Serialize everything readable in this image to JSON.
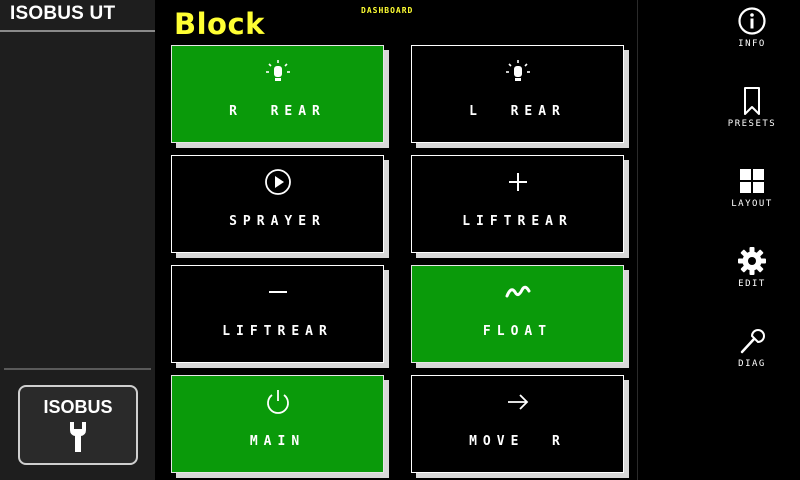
{
  "app": {
    "title": "ISOBUS UT"
  },
  "left_panel": {
    "isobus_button_label": "ISOBUS"
  },
  "header": {
    "title": "Block",
    "subtitle": "DASHBOARD"
  },
  "tiles": [
    {
      "label": "R  REAR",
      "icon": "lightbulb-icon",
      "active": true
    },
    {
      "label": "L  REAR",
      "icon": "lightbulb-icon",
      "active": false
    },
    {
      "label": "SPRAYER",
      "icon": "play-circle-icon",
      "active": false
    },
    {
      "label": "LIFTREAR",
      "icon": "plus-icon",
      "active": false
    },
    {
      "label": "LIFTREAR",
      "icon": "minus-icon",
      "active": false
    },
    {
      "label": "FLOAT",
      "icon": "wave-icon",
      "active": true
    },
    {
      "label": "MAIN",
      "icon": "power-icon",
      "active": true
    },
    {
      "label": "MOVE  R",
      "icon": "arrow-right-icon",
      "active": false
    }
  ],
  "right_panel": {
    "items": [
      {
        "label": "INFO",
        "icon": "info-icon"
      },
      {
        "label": "PRESETS",
        "icon": "bookmark-icon"
      },
      {
        "label": "LAYOUT",
        "icon": "grid-icon"
      },
      {
        "label": "EDIT",
        "icon": "gear-icon"
      },
      {
        "label": "DIAG",
        "icon": "wrench-icon"
      }
    ]
  },
  "colors": {
    "accent_yellow": "#ffff33",
    "active_green": "#0a9a0a",
    "panel_gray": "#1e1e1e"
  }
}
